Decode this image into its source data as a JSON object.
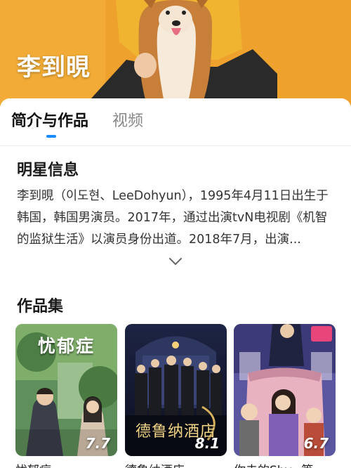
{
  "hero": {
    "title": "李到晛"
  },
  "tabs": [
    {
      "label": "简介与作品",
      "active": true
    },
    {
      "label": "视频",
      "active": false
    }
  ],
  "bio": {
    "title": "明星信息",
    "text": "李到晛（이도현、LeeDohyun），1995年4月11日出生于韩国，韩国男演员。2017年，通过出演tvN电视剧《机智的监狱生活》以演员身份出道。2018年7月，出演..."
  },
  "works": {
    "title": "作品集",
    "items": [
      {
        "poster_title": "忧郁症",
        "rating": "7.7",
        "name": "忧郁症"
      },
      {
        "poster_title": "德鲁纳酒店",
        "rating": "8.1",
        "name": "德鲁纳酒店"
      },
      {
        "poster_title": "",
        "rating": "6.7",
        "name": "你去的Shy...等"
      }
    ]
  },
  "colors": {
    "accent": "#1a8cff",
    "hero_bg": "#e99425"
  }
}
